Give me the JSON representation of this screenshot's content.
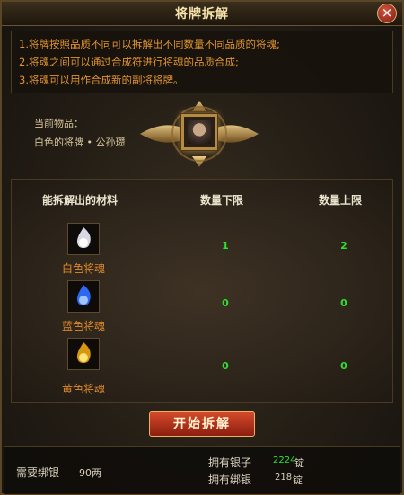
{
  "window": {
    "title": "将牌拆解",
    "close_icon": "×"
  },
  "rules": [
    "1.将牌按照品质不同可以拆解出不同数量不同品质的将魂;",
    "2.将魂之间可以通过合成符进行将魂的品质合成;",
    "3.将魂可以用作合成新的副将将牌。"
  ],
  "current_item": {
    "label": "当前物品：",
    "value": "白色的将牌 • 公孙瓒"
  },
  "table": {
    "headers": [
      "能拆解出的材料",
      "数量下限",
      "数量上限"
    ],
    "rows": [
      {
        "name": "白色将魂",
        "min": "1",
        "max": "2",
        "color": "#f0f0ff"
      },
      {
        "name": "蓝色将魂",
        "min": "0",
        "max": "0",
        "color": "#3b7dff"
      },
      {
        "name": "黄色将魂",
        "min": "0",
        "max": "0",
        "color": "#f0c020"
      }
    ]
  },
  "actions": {
    "start": "开始拆解"
  },
  "footer": {
    "need_label": "需要绑银",
    "need_value": "90两",
    "silver_label": "拥有银子",
    "silver_value": "2224",
    "silver_unit": "锭",
    "bound_label": "拥有绑银",
    "bound_value": "218",
    "bound_unit": "锭"
  },
  "colors": {
    "accent": "#e1942f",
    "positive": "#2fe02f",
    "button": "#b0301a"
  }
}
